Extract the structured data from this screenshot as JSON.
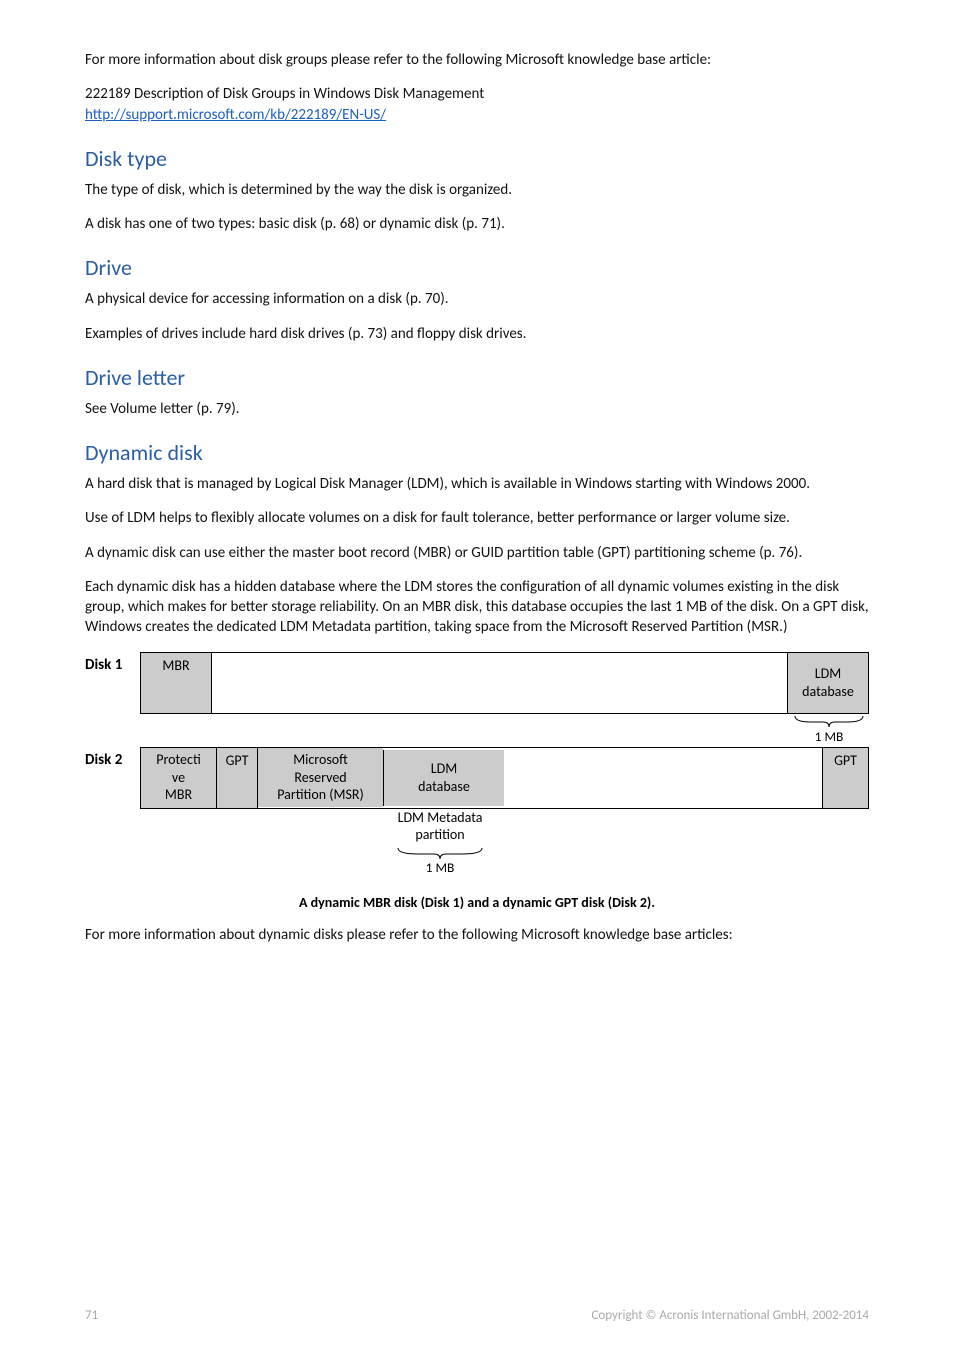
{
  "p1": "For more information about disk groups please refer to the following Microsoft knowledge base article:",
  "p2a": "222189 Description of Disk Groups in Windows Disk Management",
  "p2link": "http://support.microsoft.com/kb/222189/EN-US/",
  "h_disktype": "Disk type",
  "p3": "The type of disk, which is determined by the way the disk is organized.",
  "p4": "A disk has one of two types: basic disk (p. 68) or dynamic disk (p. 71).",
  "h_drive": "Drive",
  "p5": "A physical device for accessing information on a disk (p. 70).",
  "p6": "Examples of drives include hard disk drives (p. 73) and floppy disk drives.",
  "h_driveletter": "Drive letter",
  "p7": "See Volume letter (p. 79).",
  "h_dynamic": "Dynamic disk",
  "p8": "A hard disk that is managed by Logical Disk Manager (LDM), which is available in Windows starting with Windows 2000.",
  "p9": "Use of LDM helps to flexibly allocate volumes on a disk for fault tolerance, better performance or larger volume size.",
  "p10": "A dynamic disk can use either the master boot record (MBR) or GUID partition table (GPT) partitioning scheme (p. 76).",
  "p11": "Each dynamic disk has a hidden database where the LDM stores the configuration of all dynamic volumes existing in the disk group, which makes for better storage reliability. On an MBR disk, this database occupies the last 1 MB of the disk. On a GPT disk, Windows creates the dedicated LDM Metadata partition, taking space from the Microsoft Reserved Partition (MSR.)",
  "disk1": {
    "label": "Disk 1",
    "mbr": "MBR",
    "ldm1": "LDM",
    "ldm2": "database",
    "size": "1 MB"
  },
  "disk2": {
    "label": "Disk 2",
    "prot1": "Protecti",
    "prot2": "ve",
    "prot3": "MBR",
    "gpt1": "GPT",
    "msr1": "Microsoft",
    "msr2": "Reserved",
    "msr3": "Partition (MSR)",
    "ldm1": "LDM",
    "ldm2": "database",
    "gpt2": "GPT",
    "meta1": "LDM Metadata",
    "meta2": "partition",
    "size": "1 MB"
  },
  "caption": "A dynamic MBR disk (Disk 1) and a dynamic GPT disk (Disk 2).",
  "p12": "For more information about dynamic disks please refer to the following Microsoft knowledge base articles:",
  "footer": {
    "page": "71",
    "copyright": "Copyright © Acronis International GmbH, 2002-2014"
  }
}
